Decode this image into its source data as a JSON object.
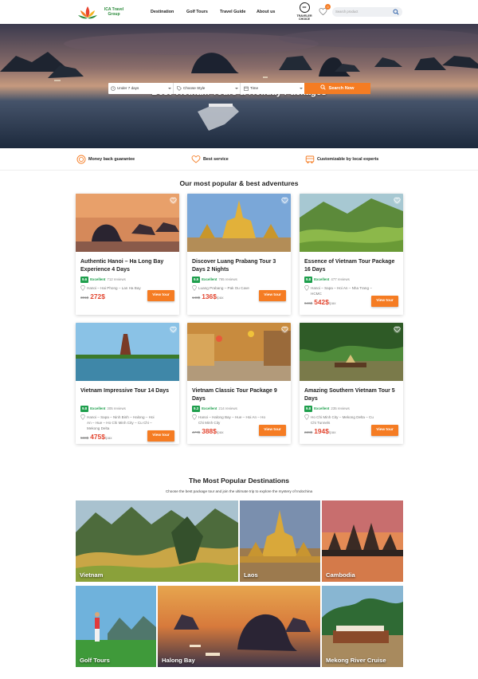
{
  "header": {
    "logo_text": "ICA Travel Group",
    "nav": [
      "Destination",
      "Golf Tours",
      "Travel Guide",
      "About us"
    ],
    "award_badge": "TRAVELER CHOICE",
    "award_icon": "owl-icon",
    "cart_count": "0",
    "search_placeholder": "Search product"
  },
  "hero": {
    "title": "Best Vietnam Tours & Holiday Packages",
    "duration_value": "Under 7 days",
    "style_value": "Choose Style",
    "time_value": "Time",
    "search_button": "Search Now"
  },
  "benefits": [
    "Money back guarantee",
    "Best service",
    "Customizable by local experts"
  ],
  "popular": {
    "title": "Our most popular & best adventures",
    "tours": [
      {
        "title": "Authentic Hanoi – Ha Long Bay Experience 4 Days",
        "score": "9.6",
        "rating_label": "Excellent",
        "reviews": "712 reviews",
        "route": "Hanoi – Hai Phong – Lan Ha Bay",
        "old_price": "301$",
        "price": "272$",
        "per": "",
        "button": "View tour"
      },
      {
        "title": "Discover Luang Prabang Tour 3 Days 2 Nights",
        "score": "9.9",
        "rating_label": "Excellent",
        "reviews": "765 reviews",
        "route": "Luang Prabang – Pak Ou Cave",
        "old_price": "148$",
        "price": "136$",
        "per": "/pax",
        "button": "View tour"
      },
      {
        "title": "Essence of Vietnam Tour Package 16 Days",
        "score": "9.8",
        "rating_label": "Excellent",
        "reviews": "477 reviews",
        "route": "Hanoi – Sapa – Hoi An – Nha Trang – HCMC",
        "old_price": "646$",
        "price": "542$",
        "per": "/pax",
        "button": "View tour"
      },
      {
        "title": "Vietnam Impressive Tour 14 Days",
        "score": "9.8",
        "rating_label": "Excellent",
        "reviews": "305 reviews",
        "route": "Hanoi – Sapa – Ninh Binh – Halong – Hoi An – Hue – Ho Chi Minh City – Cu Chi – Mekong Delta",
        "old_price": "580$",
        "price": "475$",
        "per": "/pax",
        "button": "View tour"
      },
      {
        "title": "Vietnam Classic Tour Package 9 Days",
        "score": "9.3",
        "rating_label": "Excellent",
        "reviews": "214 reviews",
        "route": "Hanoi – Halong Bay – Hue – Hoi An – Ho Chi Minh City",
        "old_price": "477$",
        "price": "388$",
        "per": "/pax",
        "button": "View tour"
      },
      {
        "title": "Amazing Southern Vietnam Tour 5 Days",
        "score": "9.8",
        "rating_label": "Excellent",
        "reviews": "235 reviews",
        "route": "Ho Chi Minh City – Mekong Delta – Cu Chi Tunnels",
        "old_price": "228$",
        "price": "194$",
        "per": "/pax",
        "button": "View tour"
      }
    ]
  },
  "destinations": {
    "title": "The Most Popular Destinations",
    "subtitle": "Choose the best package tour and join the ultimate trip to explore the mystery of Indochina",
    "items": [
      "Vietnam",
      "Laos",
      "Cambodia",
      "Golf Tours",
      "Halong Bay",
      "Mekong River Cruise"
    ]
  },
  "colors": {
    "accent": "#f57c23",
    "rating": "#1f9f4d",
    "price": "#e2452f"
  }
}
